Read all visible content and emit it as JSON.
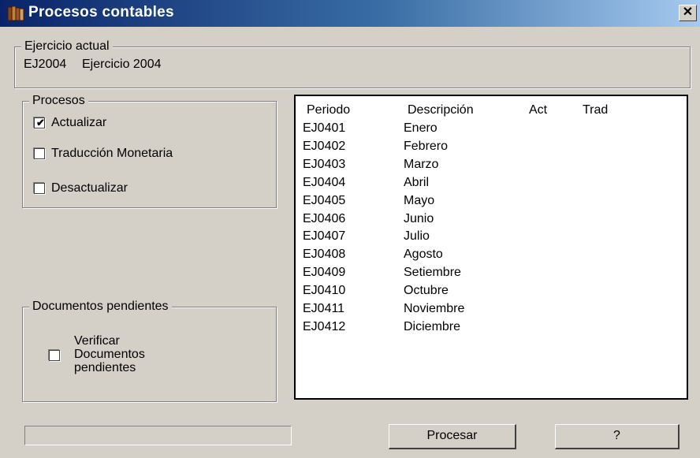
{
  "window": {
    "title": "Procesos contables",
    "close_label": "✕",
    "icon": "book-stack-icon"
  },
  "ejercicio": {
    "legend": "Ejercicio actual",
    "code": "EJ2004",
    "description": "Ejercicio 2004"
  },
  "procesos": {
    "legend": "Procesos",
    "options": [
      {
        "label": "Actualizar",
        "checked": true
      },
      {
        "label": "Traducción Monetaria",
        "checked": false
      },
      {
        "label": "Desactualizar",
        "checked": false
      }
    ]
  },
  "documentos": {
    "legend": "Documentos pendientes",
    "check_line1": "Verificar",
    "check_line2": "Documentos",
    "check_line3": "pendientes",
    "checked": false
  },
  "periods": {
    "headers": {
      "periodo": "Periodo",
      "descripcion": "Descripción",
      "act": "Act",
      "trad": "Trad"
    },
    "rows": [
      {
        "code": "EJ0401",
        "desc": "Enero"
      },
      {
        "code": "EJ0402",
        "desc": "Febrero"
      },
      {
        "code": "EJ0403",
        "desc": "Marzo"
      },
      {
        "code": "EJ0404",
        "desc": "Abril"
      },
      {
        "code": "EJ0405",
        "desc": "Mayo"
      },
      {
        "code": "EJ0406",
        "desc": "Junio"
      },
      {
        "code": "EJ0407",
        "desc": "Julio"
      },
      {
        "code": "EJ0408",
        "desc": "Agosto"
      },
      {
        "code": "EJ0409",
        "desc": "Setiembre"
      },
      {
        "code": "EJ0410",
        "desc": "Octubre"
      },
      {
        "code": "EJ0411",
        "desc": "Noviembre"
      },
      {
        "code": "EJ0412",
        "desc": "Diciembre"
      }
    ]
  },
  "status_text": "",
  "buttons": {
    "procesar": "Procesar",
    "help": "?"
  }
}
